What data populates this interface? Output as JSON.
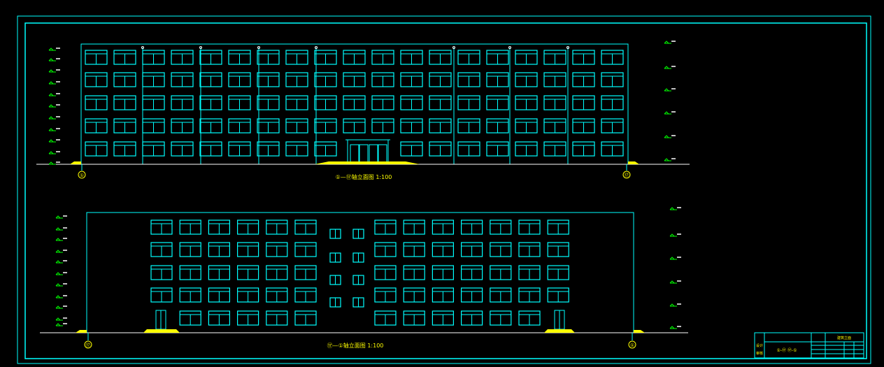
{
  "colors": {
    "background": "#000000",
    "line": "#00ffff",
    "ground": "#ffffff",
    "ground_fill": "#ffff00",
    "level_label": "#ffffff",
    "level_tick": "#00ff00"
  },
  "elevation_top": {
    "title": "①—⑰轴立面图 1:100",
    "axis_left": "①",
    "axis_right": "⑰",
    "floors": 5,
    "bays_per_floor": 19
  },
  "elevation_bottom": {
    "title": "⑰—①轴立面图 1:100",
    "axis_left": "⑰",
    "axis_right": "①",
    "floors": 5,
    "left_windows_per_floor": 6,
    "right_windows_per_floor": 7,
    "stair_windows_pairs": 4
  },
  "title_block": {
    "project": "建筑立面",
    "drawing_name": "①-⑰ ⑰-①",
    "label_design": "设计",
    "label_check": "审核"
  }
}
